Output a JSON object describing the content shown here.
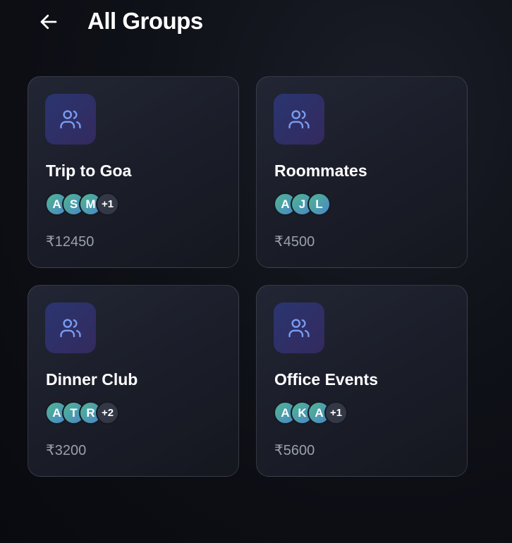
{
  "header": {
    "title": "All Groups"
  },
  "groups": [
    {
      "name": "Trip to Goa",
      "members": [
        "A",
        "S",
        "M"
      ],
      "extra": "+1",
      "amount": "₹12450"
    },
    {
      "name": "Roommates",
      "members": [
        "A",
        "J",
        "L"
      ],
      "extra": "",
      "amount": "₹4500"
    },
    {
      "name": "Dinner Club",
      "members": [
        "A",
        "T",
        "R"
      ],
      "extra": "+2",
      "amount": "₹3200"
    },
    {
      "name": "Office Events",
      "members": [
        "A",
        "K",
        "A"
      ],
      "extra": "+1",
      "amount": "₹5600"
    }
  ],
  "icons": {
    "back": "arrow-left-icon",
    "group": "users-icon"
  },
  "colors": {
    "background": "#0f1118",
    "card": "#1c1f2a",
    "icon_accent": "#7a9cf0",
    "amount_text": "#9aa0ad"
  }
}
